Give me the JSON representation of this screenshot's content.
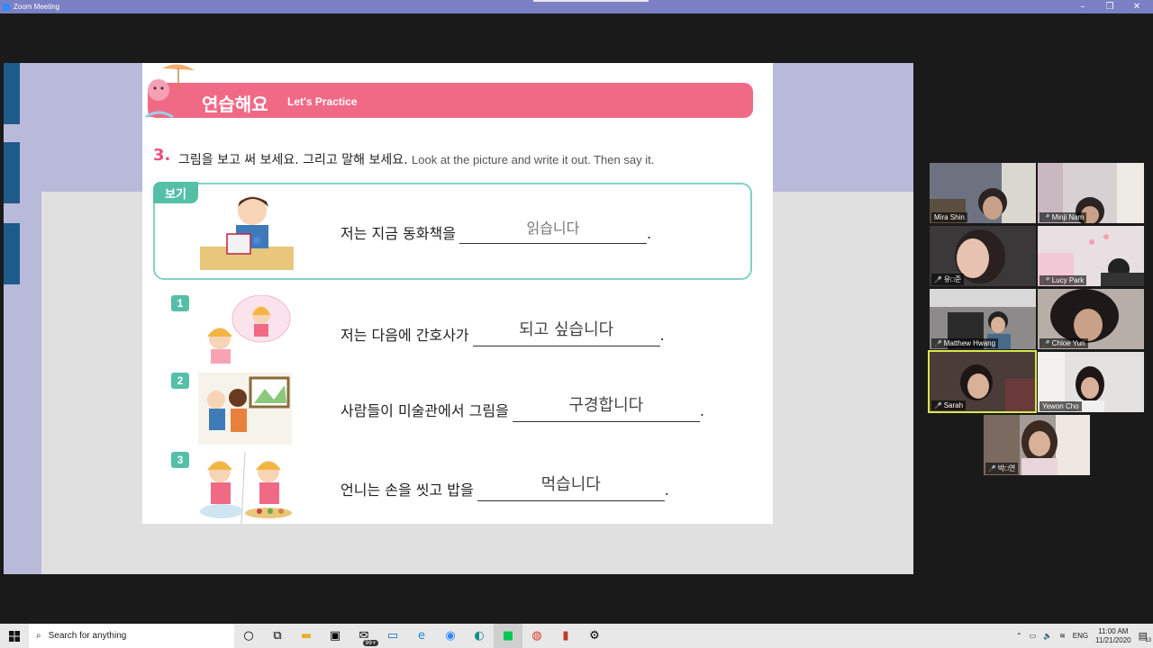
{
  "window": {
    "title": "Zoom Meeting",
    "minimize": "–",
    "restore": "❐",
    "close": "✕"
  },
  "worksheet": {
    "banner_ko": "연습해요",
    "banner_en": "Let's Practice",
    "question_number": "3.",
    "question_ko": "그림을 보고 써 보세요. 그리고 말해 보세요.",
    "question_en": "Look at the picture and write it out. Then say it.",
    "example_tag": "보기",
    "example": {
      "before": "저는 지금 동화책을",
      "answer": "읽습니다",
      "after": "."
    },
    "items": [
      {
        "num": "1",
        "before": "저는 다음에 간호사가",
        "answer": "되고 싶습니다",
        "after": "."
      },
      {
        "num": "2",
        "before": "사람들이 미술관에서 그림을",
        "answer": "구경합니다",
        "after": "."
      },
      {
        "num": "3",
        "before": "언니는 손을 씻고 밥을",
        "answer": "먹습니다",
        "after": "."
      }
    ]
  },
  "participants": [
    {
      "name": "Mira Shin",
      "muted": false
    },
    {
      "name": "Minji Nam",
      "muted": true
    },
    {
      "name": "유□준",
      "muted": true
    },
    {
      "name": "Lucy Park",
      "muted": true
    },
    {
      "name": "Matthew Hwang",
      "muted": true
    },
    {
      "name": "Chloe Yun",
      "muted": true
    },
    {
      "name": "Sarah",
      "muted": true,
      "active": true
    },
    {
      "name": "Yewon Cho",
      "muted": false
    },
    {
      "name": "박□연",
      "muted": true
    }
  ],
  "taskbar": {
    "search_placeholder": "Search for anything",
    "mail_badge": "99+",
    "language": "ENG",
    "time": "11:00 AM",
    "date": "11/21/2020",
    "notification_count": "13"
  }
}
